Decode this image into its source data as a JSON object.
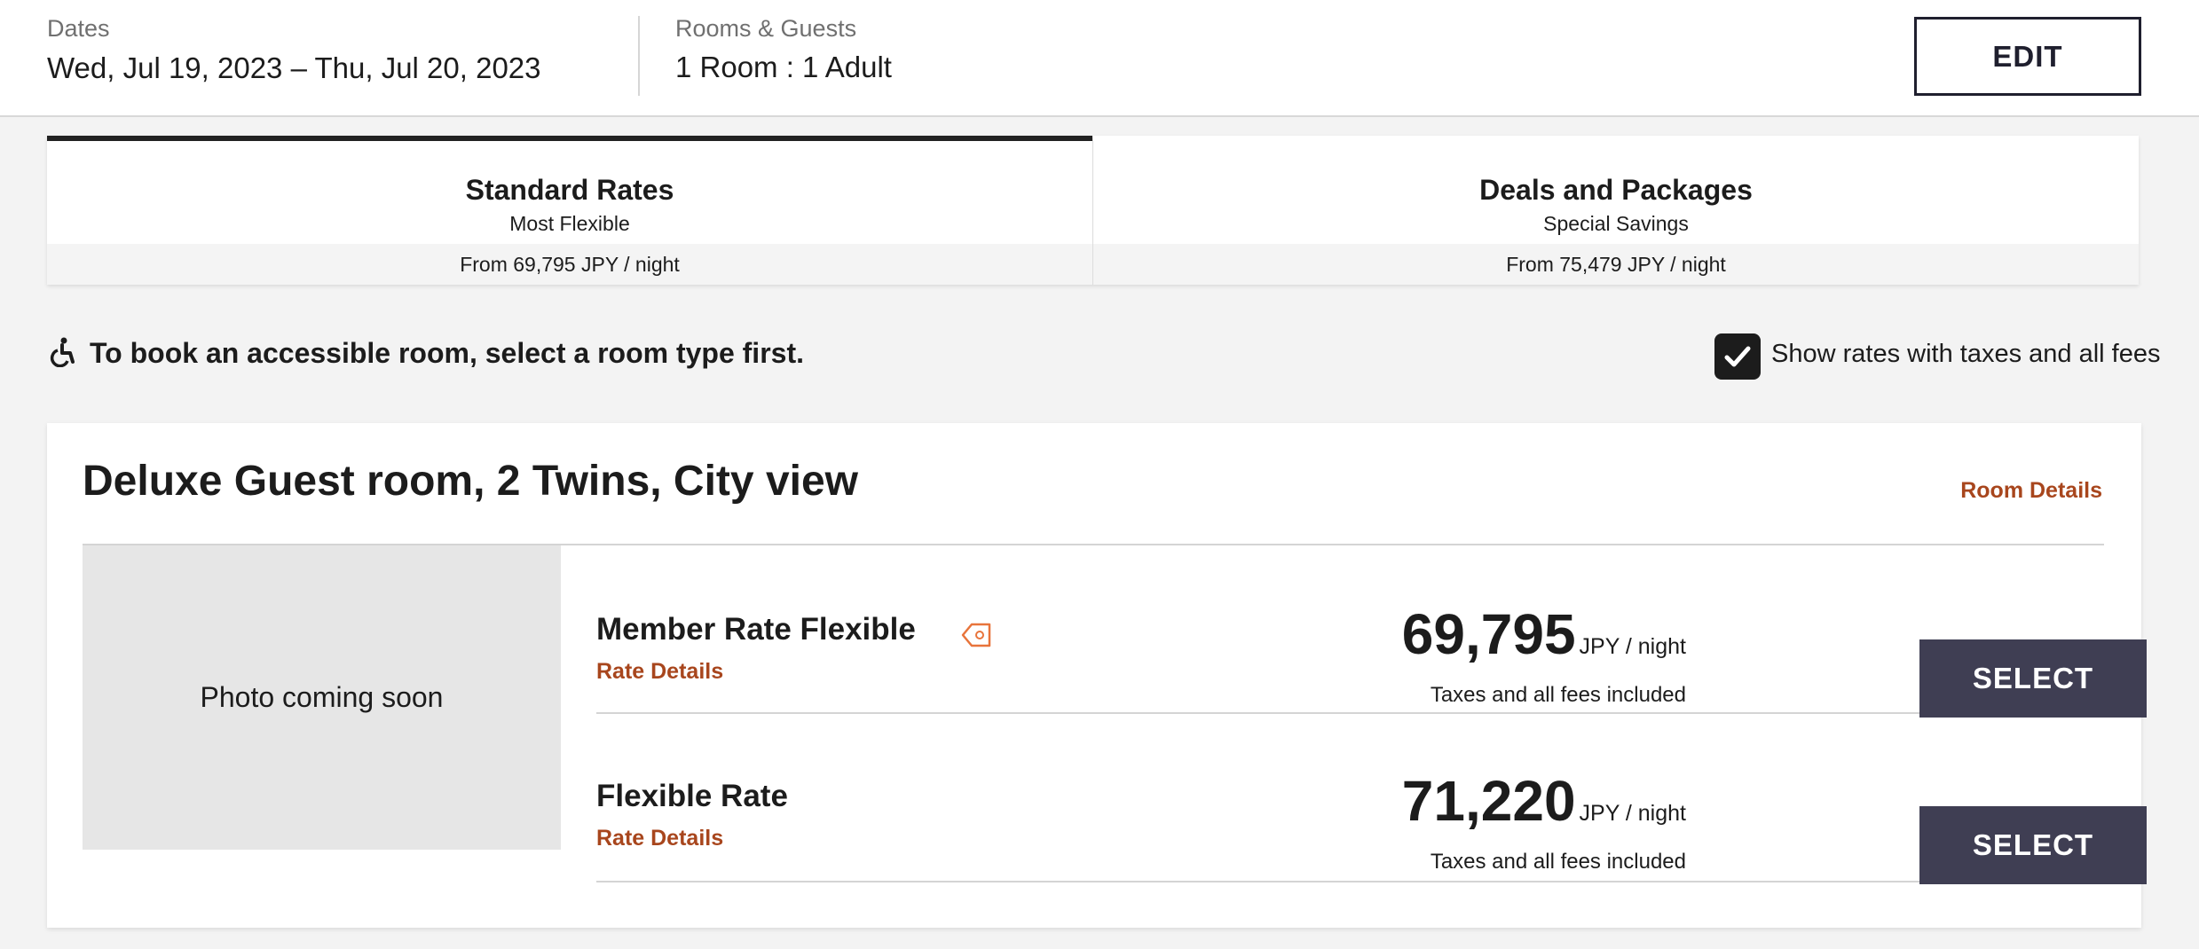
{
  "header": {
    "dates_label": "Dates",
    "dates_value": "Wed, Jul 19, 2023 – Thu, Jul 20, 2023",
    "rooms_label": "Rooms & Guests",
    "rooms_value": "1 Room : 1 Adult",
    "edit_label": "EDIT"
  },
  "tabs": [
    {
      "title": "Standard Rates",
      "subtitle": "Most Flexible",
      "price": "From 69,795 JPY / night",
      "active": true
    },
    {
      "title": "Deals and Packages",
      "subtitle": "Special Savings",
      "price": "From 75,479 JPY / night",
      "active": false
    }
  ],
  "accessibility": {
    "icon": "wheelchair-icon",
    "text": "To book an accessible room, select a room type first."
  },
  "taxes_toggle": {
    "checked": true,
    "label": "Show rates with taxes and all fees"
  },
  "room": {
    "title": "Deluxe Guest room, 2 Twins, City view",
    "details_link": "Room Details",
    "photo_placeholder": "Photo coming soon",
    "rates": [
      {
        "name": "Member Rate Flexible",
        "icon": "member-tag-icon",
        "details_link": "Rate Details",
        "price": "69,795",
        "unit": "JPY / night",
        "note": "Taxes and all fees included",
        "button": "SELECT"
      },
      {
        "name": "Flexible Rate",
        "details_link": "Rate Details",
        "price": "71,220",
        "unit": "JPY / night",
        "note": "Taxes and all fees included",
        "button": "SELECT"
      }
    ]
  },
  "colors": {
    "accent_link": "#a8461d",
    "button_bg": "#3f3e53",
    "page_bg": "#f3f3f3",
    "member_tag": "#e8743b"
  }
}
